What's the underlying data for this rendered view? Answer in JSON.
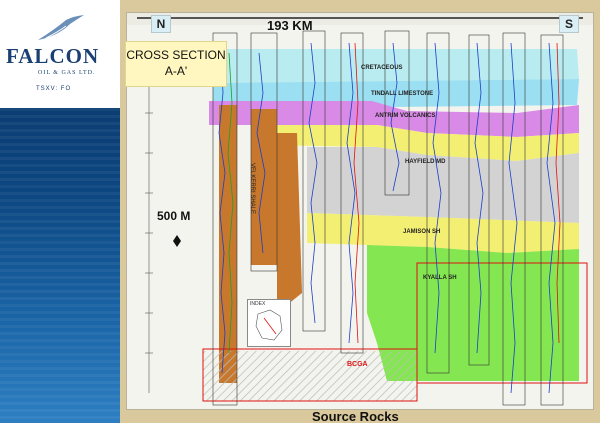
{
  "brand": {
    "name": "FALCON",
    "subtitle": "OIL & GAS LTD.",
    "ticker": "TSXV: FO"
  },
  "colors": {
    "brand_blue": "#0c4680",
    "panel_tan": "#d9c99c",
    "cretaceous": "#b9ecf0",
    "tindall_limestone": "#9be0f2",
    "antrim_volcanics": "#d98ae6",
    "hayfield_top": "#f3ef72",
    "hayfield_md": "#d3d3d3",
    "jamison_sh": "#f3ef72",
    "kyalla_sh": "#84e650",
    "velkerri_shale": "#c8782c",
    "bcga_outline": "#e01010"
  },
  "slide": {
    "direction_left": "N",
    "direction_right": "S",
    "distance_label": "193 KM",
    "title_line1": "CROSS SECTION",
    "title_line2": "A-A'",
    "vertical_scale": "500 M",
    "caption": "Source Rocks",
    "index_label": "INDEX"
  },
  "formations": {
    "cretaceous": "CRETACEOUS",
    "tindall": "TINDALL LIMESTONE",
    "antrim": "ANTRIM VOLCANICS",
    "hayfield": "HAYFIELD MD",
    "jamison": "JAMISON SH",
    "kyalla": "KYALLA SH",
    "velkerri": "VELKERRI SHALE",
    "bcga": "BCGA"
  }
}
